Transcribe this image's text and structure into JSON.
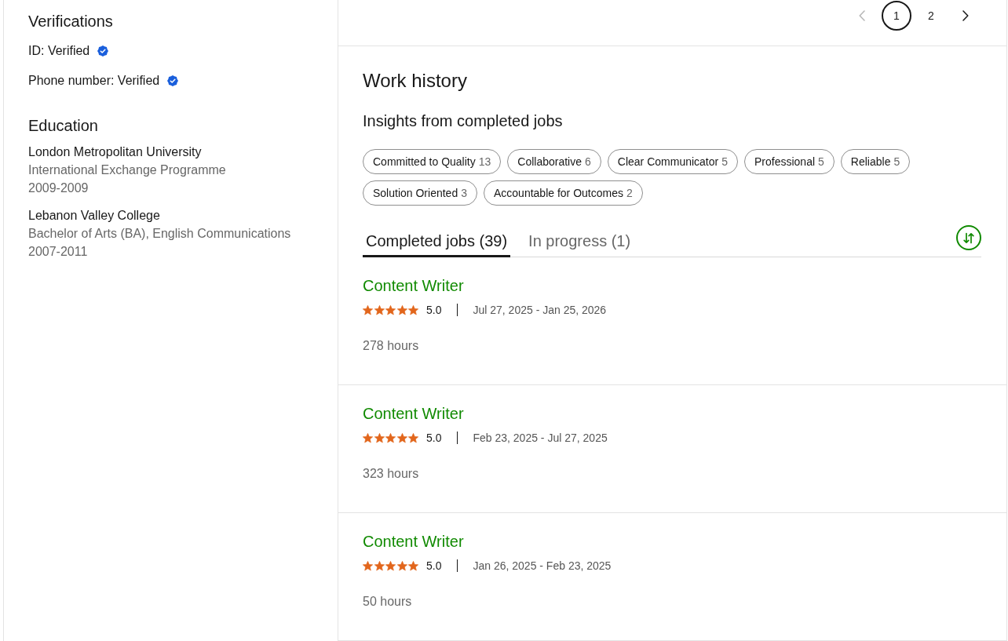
{
  "verifications": {
    "title": "Verifications",
    "items": [
      {
        "label": "ID: Verified",
        "verified": true
      },
      {
        "label": "Phone number: Verified",
        "verified": true
      }
    ]
  },
  "education": {
    "title": "Education",
    "items": [
      {
        "school": "London Metropolitan University",
        "degree": "International Exchange Programme",
        "years": "2009-2009"
      },
      {
        "school": "Lebanon Valley College",
        "degree": "Bachelor of Arts (BA), English Communications",
        "years": "2007-2011"
      }
    ]
  },
  "pagination": {
    "previous": {
      "disabled": true
    },
    "pages": [
      {
        "label": "1",
        "selected": true
      },
      {
        "label": "2",
        "selected": false
      }
    ],
    "next": {
      "disabled": false
    }
  },
  "work_history": {
    "title": "Work history",
    "insights_title": "Insights from completed jobs",
    "insights": [
      {
        "label": "Committed to Quality",
        "count": "13"
      },
      {
        "label": "Collaborative",
        "count": "6"
      },
      {
        "label": "Clear Communicator",
        "count": "5"
      },
      {
        "label": "Professional",
        "count": "5"
      },
      {
        "label": "Reliable",
        "count": "5"
      },
      {
        "label": "Solution Oriented",
        "count": "3"
      },
      {
        "label": "Accountable for Outcomes",
        "count": "2"
      }
    ],
    "tabs": [
      {
        "label": "Completed jobs (39)",
        "selected": true
      },
      {
        "label": "In progress (1)",
        "selected": false
      }
    ],
    "jobs": [
      {
        "title": "Content Writer",
        "stars": 5,
        "rating": "5.0",
        "dates": "Jul 27, 2025 - Jan 25, 2026",
        "hours": "278 hours"
      },
      {
        "title": "Content Writer",
        "stars": 5,
        "rating": "5.0",
        "dates": "Feb 23, 2025 - Jul 27, 2025",
        "hours": "323 hours"
      },
      {
        "title": "Content Writer",
        "stars": 5,
        "rating": "5.0",
        "dates": "Jan 26, 2025 - Feb 23, 2025",
        "hours": "50 hours"
      }
    ]
  }
}
